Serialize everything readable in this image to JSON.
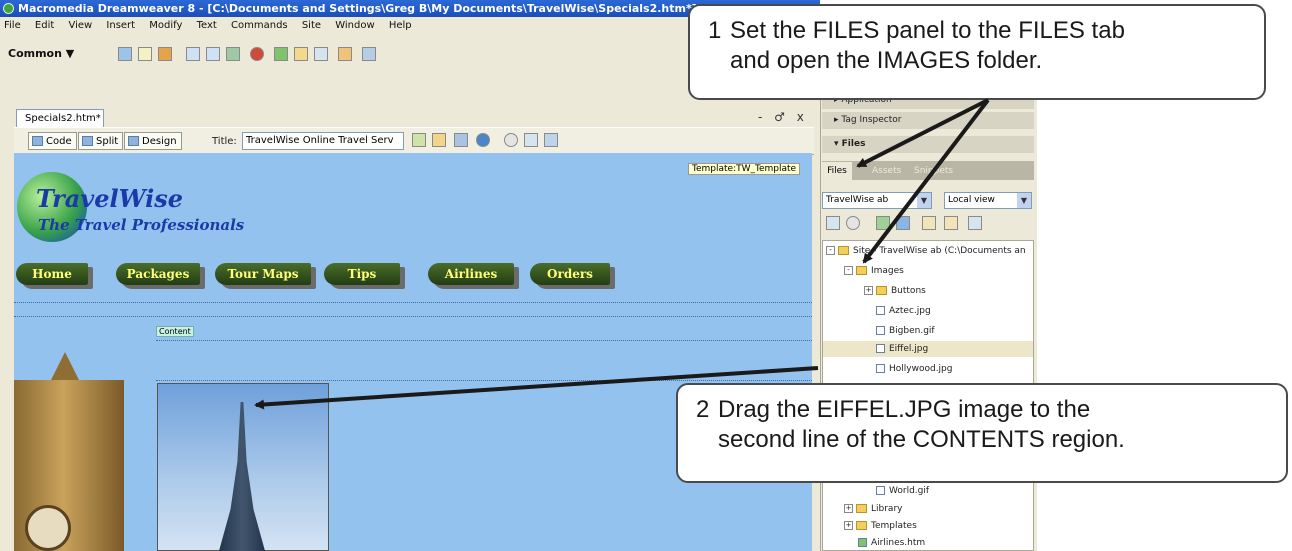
{
  "window": {
    "title": "Macromedia Dreamweaver 8 - [C:\\Documents and Settings\\Greg B\\My Documents\\TravelWise\\Specials2.htm*]"
  },
  "menu": [
    "File",
    "Edit",
    "View",
    "Insert",
    "Modify",
    "Text",
    "Commands",
    "Site",
    "Window",
    "Help"
  ],
  "insert_bar": {
    "category": "Common ▼"
  },
  "document": {
    "tab": "Specials2.htm*",
    "window_controls": "- ♂ x",
    "toolbar": {
      "code_label": "Code",
      "split_label": "Split",
      "design_label": "Design",
      "title_label": "Title:",
      "title_value": "TravelWise Online Travel Serv"
    }
  },
  "design": {
    "template_tag": "Template:TW_Template",
    "logo": "TravelWise",
    "tagline": "The Travel Professionals",
    "nav": [
      "Home",
      "Packages",
      "Tour Maps",
      "Tips",
      "Airlines",
      "Orders"
    ],
    "content_tag": "Content"
  },
  "panels": {
    "application": "▸ Application",
    "tag_inspector": "▸ Tag Inspector",
    "files_header": "▾ Files",
    "tabs": {
      "files": "Files",
      "assets": "Assets",
      "snippets": "Snippets"
    },
    "site_select": "TravelWise ab",
    "view_select": "Local view",
    "tree": {
      "root": "Site - TravelWise ab (C:\\Documents an",
      "images": "Images",
      "buttons": "Buttons",
      "files": [
        "Aztec.jpg",
        "Bigben.gif",
        "Eiffel.jpg",
        "Hollywood.jpg"
      ],
      "world": "World.gif",
      "library": "Library",
      "templates": "Templates",
      "airlines": "Airlines.htm"
    }
  },
  "callouts": {
    "one": {
      "num": "1",
      "line1": "Set the FILES panel to the FILES tab",
      "line2": "and open the IMAGES folder."
    },
    "two": {
      "num": "2",
      "line1": "Drag the EIFFEL.JPG image to the",
      "line2": "second line of the CONTENTS region."
    }
  },
  "colors": {
    "design_bg": "#94c2ee",
    "nav_text": "#ffff7a",
    "callout_border": "#4a4a4a"
  }
}
